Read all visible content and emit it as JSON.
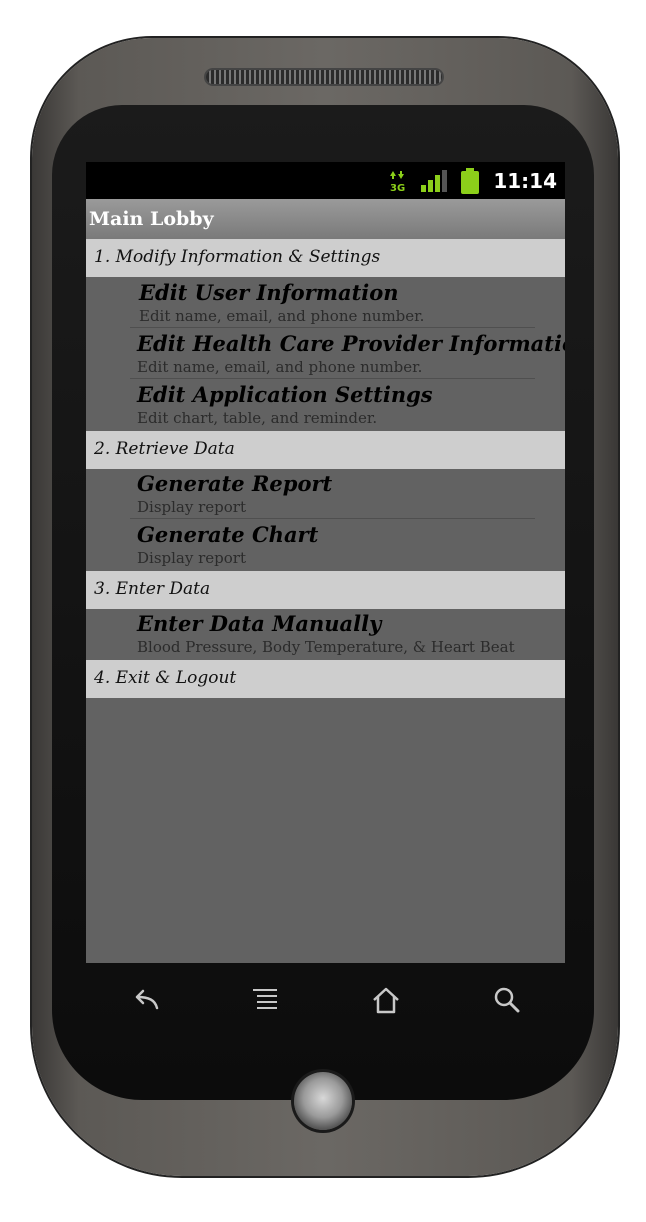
{
  "status": {
    "clock": "11:14",
    "network_type": "3G"
  },
  "app": {
    "title": "Main Lobby"
  },
  "sections": [
    {
      "label": "1. Modify Information & Settings",
      "items": [
        {
          "title": "Edit User Information",
          "subtitle": "Edit name, email, and phone number."
        },
        {
          "title": "Edit Health Care Provider Information",
          "subtitle": "Edit name, email, and phone number."
        },
        {
          "title": "Edit Application Settings",
          "subtitle": "Edit chart, table, and reminder."
        }
      ]
    },
    {
      "label": "2. Retrieve Data",
      "items": [
        {
          "title": "Generate Report",
          "subtitle": "Display report"
        },
        {
          "title": "Generate Chart",
          "subtitle": "Display report"
        }
      ]
    },
    {
      "label": "3. Enter Data",
      "items": [
        {
          "title": "Enter Data Manually",
          "subtitle": "Blood Pressure, Body Temperature, & Heart Beat"
        }
      ]
    },
    {
      "label": "4. Exit & Logout",
      "items": []
    }
  ],
  "navbar": {
    "icons": [
      "back-icon",
      "menu-icon",
      "home-icon",
      "search-icon"
    ]
  },
  "colors": {
    "screen_bg": "#626262",
    "section_bg": "#cecece",
    "status_bg": "#000000",
    "accent_green": "#8ccf1a"
  }
}
